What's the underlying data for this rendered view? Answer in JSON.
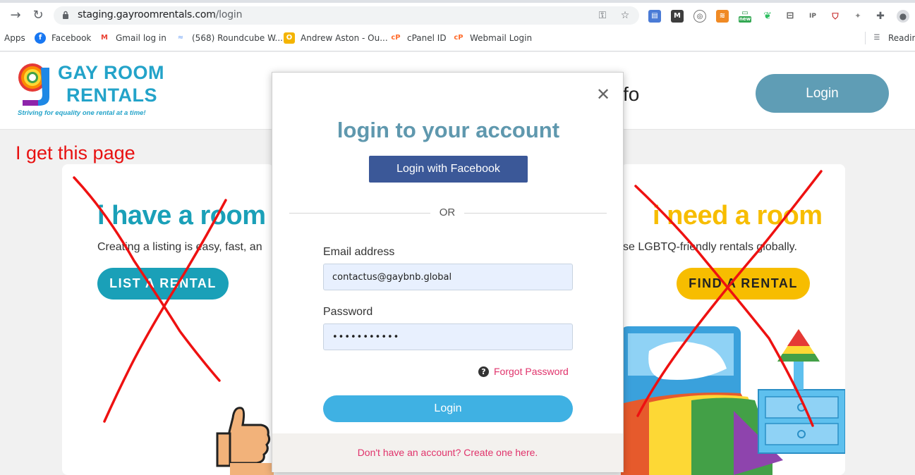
{
  "browser": {
    "url_host": "staging.gayroomrentals.com",
    "url_path": "/login",
    "bookmarks": [
      {
        "label": "Apps"
      },
      {
        "label": "Facebook"
      },
      {
        "label": "Gmail log in"
      },
      {
        "label": "(568) Roundcube W..."
      },
      {
        "label": "Andrew Aston - Ou..."
      },
      {
        "label": "cPanel ID"
      },
      {
        "label": "Webmail Login"
      },
      {
        "label": "Reading"
      }
    ],
    "ext_new_badge": "new",
    "ext_ip_label": "IP"
  },
  "site": {
    "logo_line1": "GAY ROOM",
    "logo_line2": "RENTALS",
    "tagline": "Striving for equality one rental at a time!",
    "nav_partial": "fo",
    "login_label": "Login"
  },
  "annotation": "I get this page",
  "left_card": {
    "title": "i have a room",
    "text": "Creating a listing is easy, fast, an",
    "button": "LIST A RENTAL"
  },
  "right_card": {
    "title": "i need a room",
    "text": "se LGBTQ-friendly rentals globally.",
    "button": "FIND A RENTAL"
  },
  "modal": {
    "title": "login to your account",
    "facebook_button": "Login with Facebook",
    "or": "OR",
    "email_label": "Email address",
    "email_value": "contactus@gaybnb.global",
    "password_label": "Password",
    "password_value": "•••••••••••",
    "forgot": "Forgot Password",
    "login_button": "Login",
    "signup": "Don't have an account? Create one here."
  },
  "colors": {
    "brand_blue": "#23a3c9",
    "teal": "#1aa0b8",
    "yellow": "#f7bd00",
    "facebook": "#3b5898",
    "link_pink": "#e0336b",
    "annotation_red": "#e81010"
  }
}
